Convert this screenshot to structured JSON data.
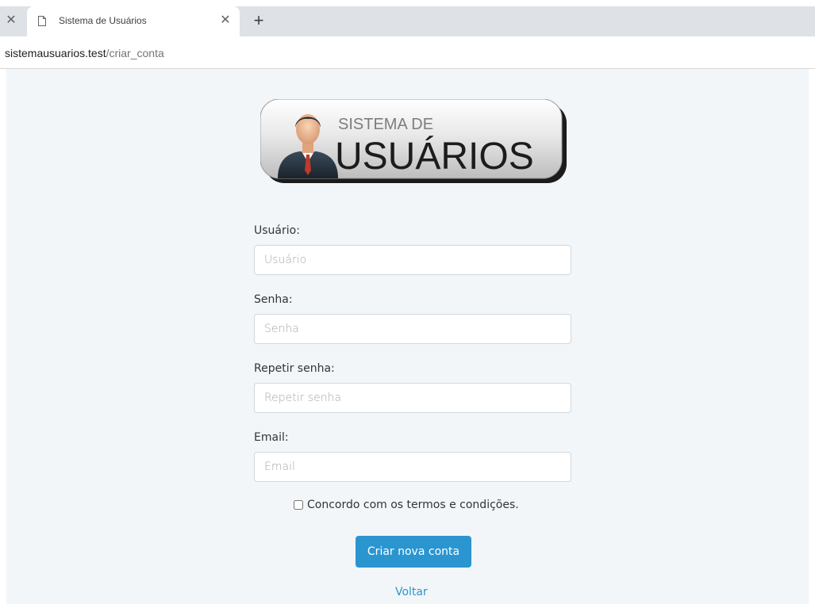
{
  "browser": {
    "tab_title": "Sistema de Usuários",
    "url_host": "sistemausuarios.test",
    "url_path": "/criar_conta"
  },
  "logo": {
    "line1": "SISTEMA DE",
    "line2": "USUÁRIOS",
    "icon": "businessman-icon"
  },
  "form": {
    "usuario": {
      "label": "Usuário:",
      "placeholder": "Usuário",
      "value": ""
    },
    "senha": {
      "label": "Senha:",
      "placeholder": "Senha",
      "value": ""
    },
    "repetir_senha": {
      "label": "Repetir senha:",
      "placeholder": "Repetir senha",
      "value": ""
    },
    "email": {
      "label": "Email:",
      "placeholder": "Email",
      "value": ""
    },
    "terms_label": "Concordo com os termos e condições.",
    "terms_checked": false,
    "submit_label": "Criar nova conta",
    "back_label": "Voltar"
  },
  "colors": {
    "accent": "#2b95d0",
    "page_bg": "#f2f6f9"
  }
}
